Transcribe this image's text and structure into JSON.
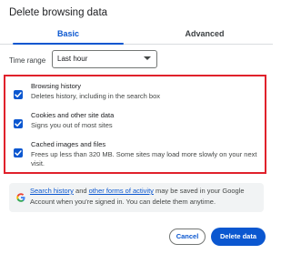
{
  "dialog": {
    "title": "Delete browsing data"
  },
  "tabs": [
    {
      "label": "Basic",
      "active": true
    },
    {
      "label": "Advanced",
      "active": false
    }
  ],
  "time_range": {
    "label": "Time range",
    "selected": "Last hour"
  },
  "options": [
    {
      "title": "Browsing history",
      "description": "Deletes history, including in the search box",
      "checked": true
    },
    {
      "title": "Cookies and other site data",
      "description": "Signs you out of most sites",
      "checked": true
    },
    {
      "title": "Cached images and files",
      "description": "Frees up less than 320 MB. Some sites may load more slowly on your next visit.",
      "checked": true
    }
  ],
  "info": {
    "link1": "Search history",
    "and": "and",
    "link2": "other forms of activity",
    "text": "may be saved in your Google Account when you're signed in. You can delete them anytime."
  },
  "buttons": {
    "cancel": "Cancel",
    "delete": "Delete data"
  },
  "colors": {
    "accent": "#0b57d0",
    "highlight_border": "#e0212b"
  },
  "icons": {
    "checkbox": "checkmark-icon",
    "select_caret": "caret-down-icon",
    "google": "google-g-icon"
  }
}
